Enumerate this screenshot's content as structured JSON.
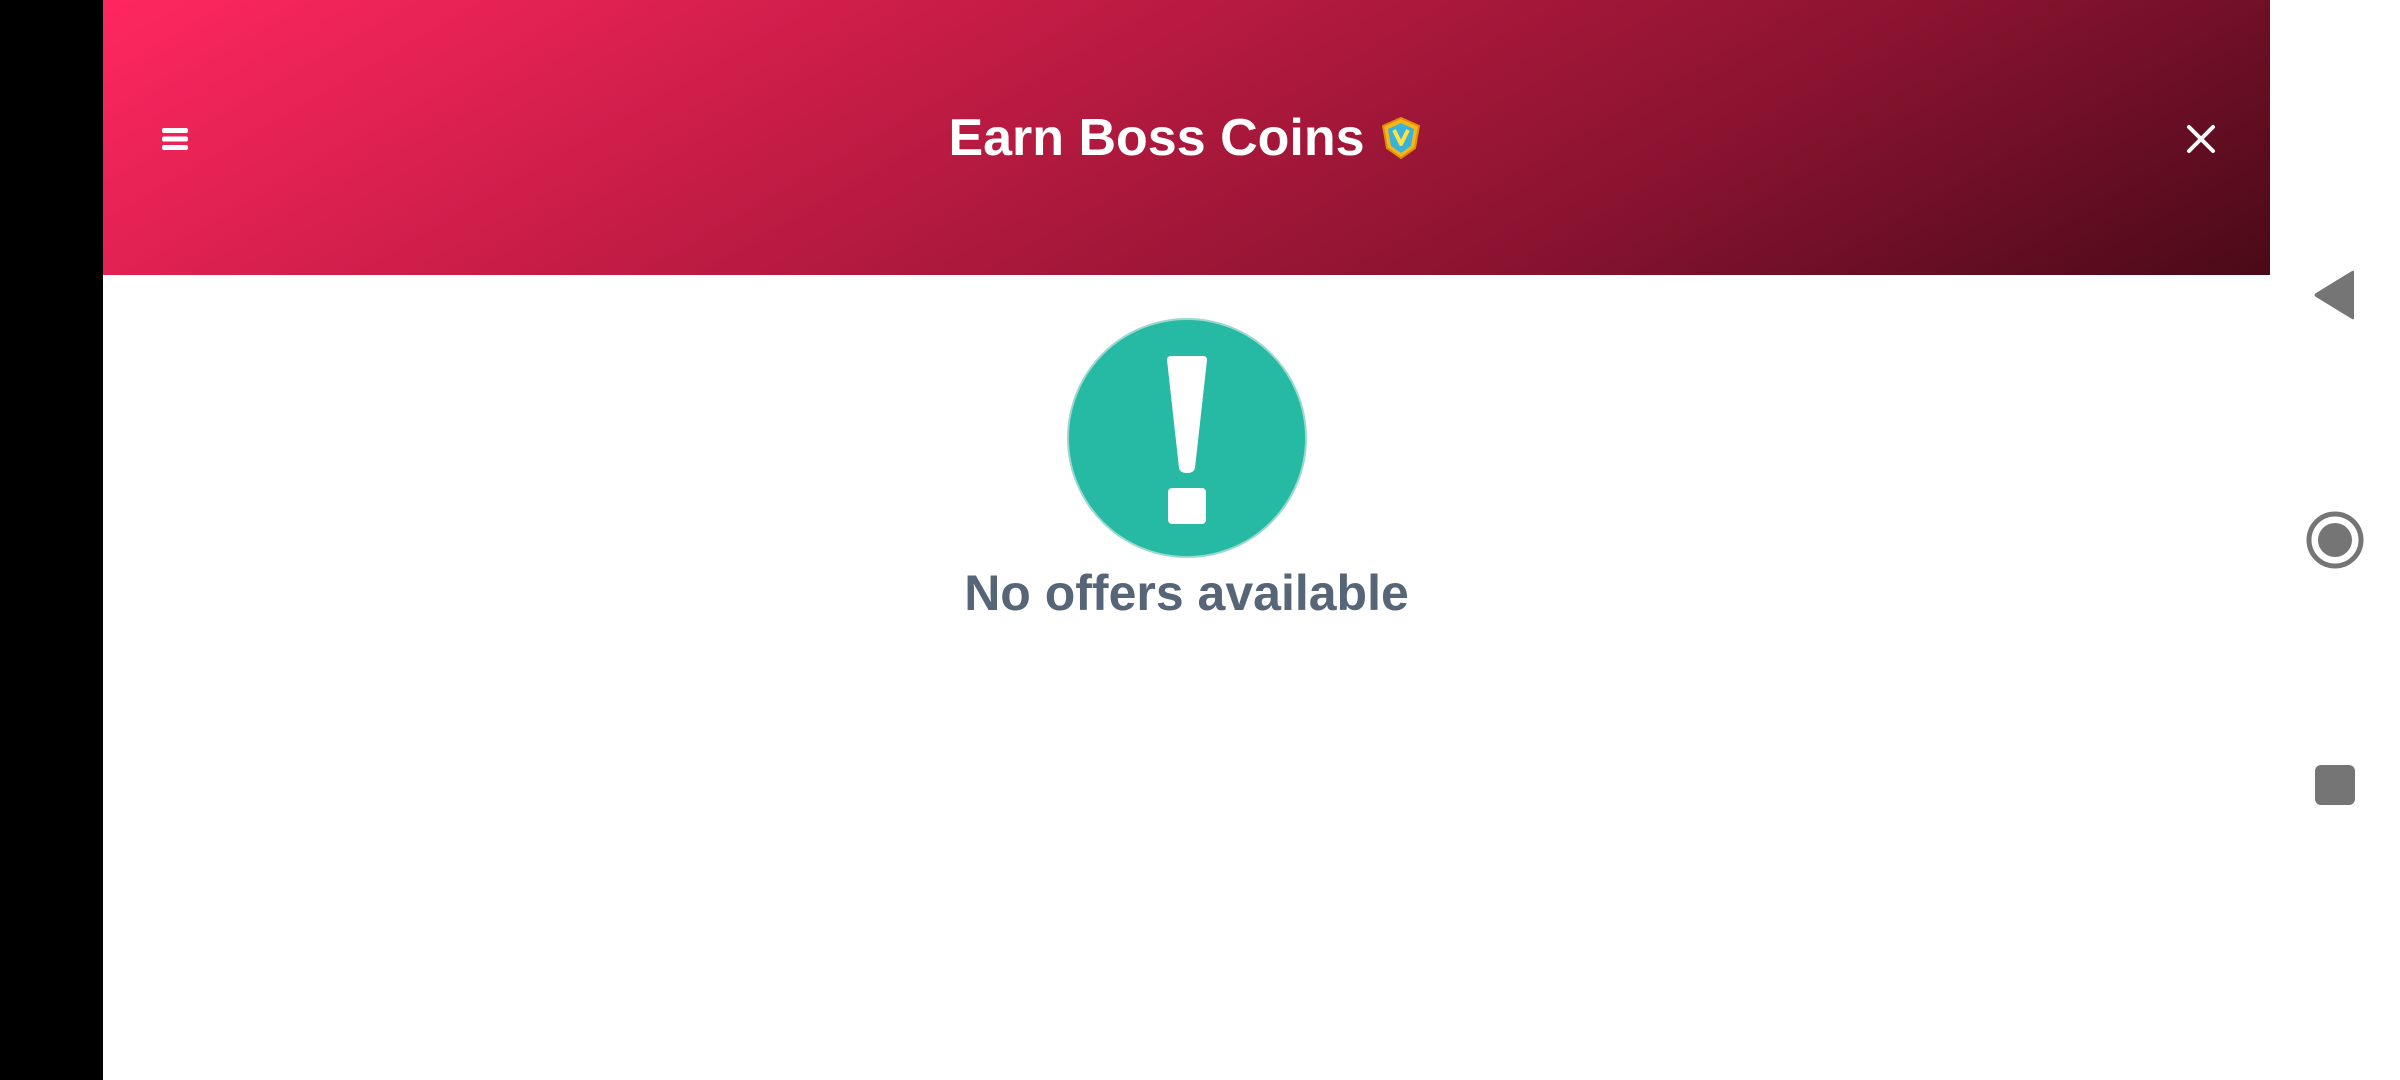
{
  "header": {
    "title": "Earn Boss Coins",
    "menu_icon": "hamburger-menu-icon",
    "coin_icon": "boss-coin-icon",
    "close_icon": "close-icon",
    "gradient_start": "#ff2760",
    "gradient_end": "#4a0a18"
  },
  "empty_state": {
    "icon": "exclamation-circle-icon",
    "icon_color": "#26b9a3",
    "message": "No offers available",
    "message_color": "#566577"
  },
  "system_nav": {
    "back_icon": "back-triangle-icon",
    "home_icon": "home-circle-icon",
    "recents_icon": "recents-square-icon"
  }
}
